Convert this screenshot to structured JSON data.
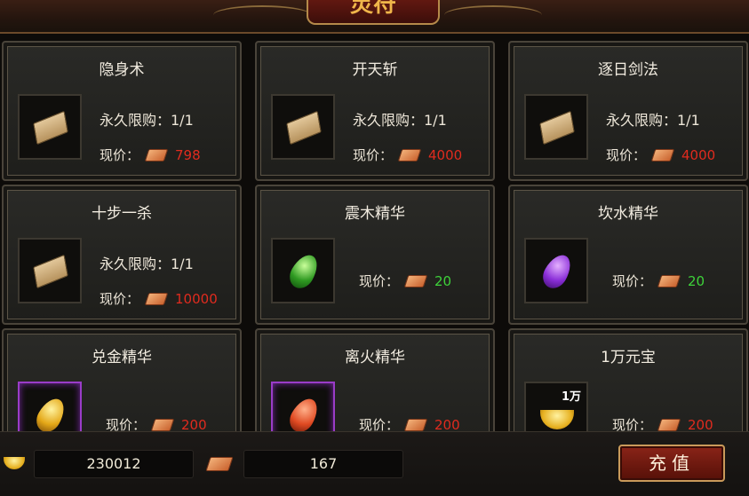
{
  "header": {
    "title": "灵符"
  },
  "items": [
    {
      "name": "隐身术",
      "icon": "book-icon",
      "limit": "永久限购：1/1",
      "price_label": "现价：",
      "price": "798",
      "price_color": "#e02b1e"
    },
    {
      "name": "开天斩",
      "icon": "book-icon",
      "limit": "永久限购：1/1",
      "price_label": "现价：",
      "price": "4000",
      "price_color": "#e02b1e"
    },
    {
      "name": "逐日剑法",
      "icon": "book-icon",
      "limit": "永久限购：1/1",
      "price_label": "现价：",
      "price": "4000",
      "price_color": "#e02b1e"
    },
    {
      "name": "十步一杀",
      "icon": "book-icon",
      "limit": "永久限购：1/1",
      "price_label": "现价：",
      "price": "10000",
      "price_color": "#e02b1e"
    },
    {
      "name": "震木精华",
      "icon": "green-gem-icon",
      "price_label": "现价：",
      "price": "20",
      "price_color": "#3ed23a"
    },
    {
      "name": "坎水精华",
      "icon": "purple-gem-icon",
      "price_label": "现价：",
      "price": "20",
      "price_color": "#3ed23a"
    },
    {
      "name": "兑金精华",
      "icon": "gold-gem-icon",
      "price_label": "现价：",
      "price": "200",
      "price_color": "#e02b1e"
    },
    {
      "name": "离火精华",
      "icon": "red-gem-icon",
      "price_label": "现价：",
      "price": "200",
      "price_color": "#e02b1e"
    },
    {
      "name": "1万元宝",
      "icon": "gold-ingot-icon",
      "icon_qty": "1万",
      "price_label": "现价：",
      "price": "200",
      "price_color": "#e02b1e"
    }
  ],
  "wallet": {
    "gold": "230012",
    "ingots": "167"
  },
  "recharge_label": "充值"
}
